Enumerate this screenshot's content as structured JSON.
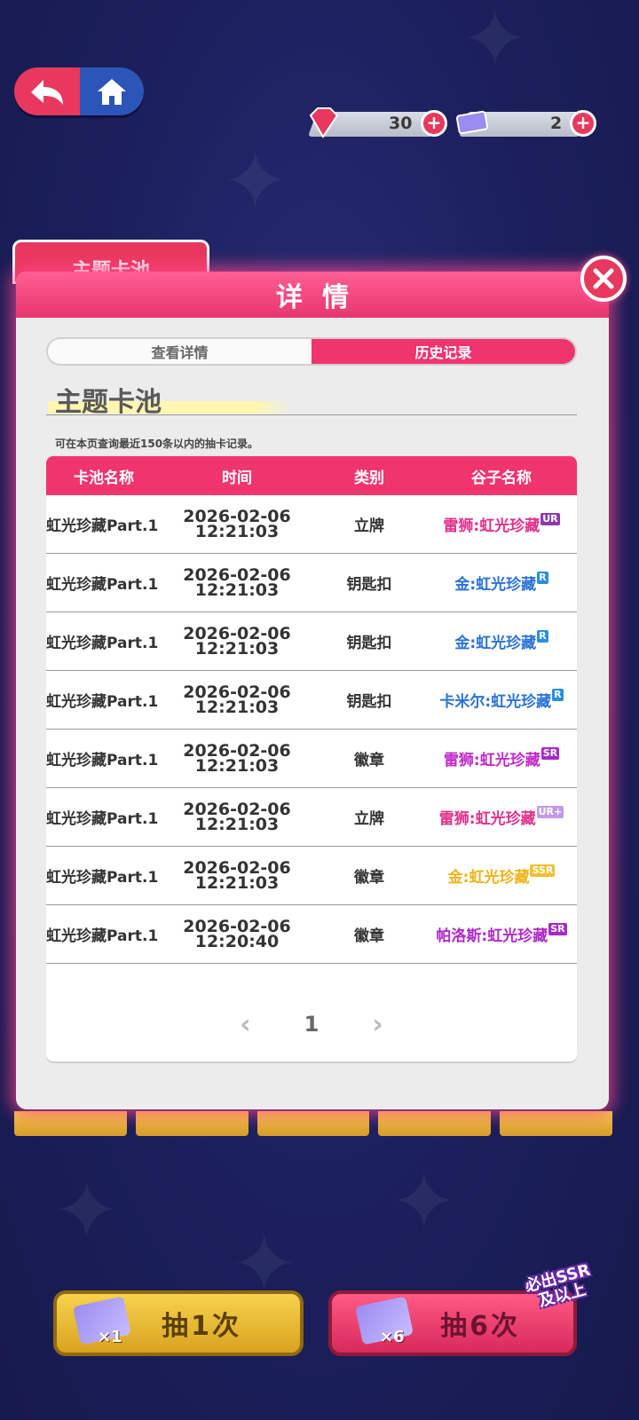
{
  "currency": {
    "gems": "30",
    "tickets": "2"
  },
  "background_tab": {
    "label": "主题卡池"
  },
  "modal": {
    "title": "详情",
    "tabs": [
      {
        "label": "查看详情",
        "active": false
      },
      {
        "label": "历史记录",
        "active": true
      }
    ],
    "section_title": "主题卡池",
    "note": "可在本页查询最近150条以内的抽卡记录。",
    "table": {
      "headers": [
        "卡池名称",
        "时间",
        "类别",
        "谷子名称"
      ],
      "rows": [
        {
          "pool": "虹光珍藏Part.1",
          "date": "2026-02-06",
          "time": "12:21:03",
          "category": "立牌",
          "item": "雷狮:虹光珍藏",
          "rarity": "UR",
          "item_color": "#e0308a",
          "badge_color": "#8a3ab0"
        },
        {
          "pool": "虹光珍藏Part.1",
          "date": "2026-02-06",
          "time": "12:21:03",
          "category": "钥匙扣",
          "item": "金:虹光珍藏",
          "rarity": "R",
          "item_color": "#2a72d8",
          "badge_color": "#2a8ee0"
        },
        {
          "pool": "虹光珍藏Part.1",
          "date": "2026-02-06",
          "time": "12:21:03",
          "category": "钥匙扣",
          "item": "金:虹光珍藏",
          "rarity": "R",
          "item_color": "#2a72d8",
          "badge_color": "#2a8ee0"
        },
        {
          "pool": "虹光珍藏Part.1",
          "date": "2026-02-06",
          "time": "12:21:03",
          "category": "钥匙扣",
          "item": "卡米尔:虹光珍藏",
          "rarity": "R",
          "item_color": "#2a72d8",
          "badge_color": "#2a8ee0"
        },
        {
          "pool": "虹光珍藏Part.1",
          "date": "2026-02-06",
          "time": "12:21:03",
          "category": "徽章",
          "item": "雷狮:虹光珍藏",
          "rarity": "SR",
          "item_color": "#c02ac8",
          "badge_color": "#a42ac8"
        },
        {
          "pool": "虹光珍藏Part.1",
          "date": "2026-02-06",
          "time": "12:21:03",
          "category": "立牌",
          "item": "雷狮:虹光珍藏",
          "rarity": "UR+",
          "item_color": "#e0308a",
          "badge_color": "#c49ae8"
        },
        {
          "pool": "虹光珍藏Part.1",
          "date": "2026-02-06",
          "time": "12:21:03",
          "category": "徽章",
          "item": "金:虹光珍藏",
          "rarity": "SSR",
          "item_color": "#f0b418",
          "badge_color": "#f0c030"
        },
        {
          "pool": "虹光珍藏Part.1",
          "date": "2026-02-06",
          "time": "12:20:40",
          "category": "徽章",
          "item": "帕洛斯:虹光珍藏",
          "rarity": "SR",
          "item_color": "#b028c8",
          "badge_color": "#a42ac8"
        }
      ]
    },
    "pager": {
      "prev": "‹",
      "page": "1",
      "next": "›"
    }
  },
  "buttons": {
    "draw1_label": "抽1次",
    "draw1_count": "×1",
    "draw6_label": "抽6次",
    "draw6_count": "×6",
    "ssr_tag": "必出SSR及以上"
  },
  "colors": {
    "accent_pink": "#f0356e",
    "background_navy": "#1c1f5c",
    "gold": "#f3c84a"
  },
  "icons": [
    "back-arrow-icon",
    "home-icon",
    "ruby-gem-icon",
    "ticket-icon",
    "plus-icon",
    "close-icon",
    "chevron-left-icon",
    "chevron-right-icon"
  ]
}
